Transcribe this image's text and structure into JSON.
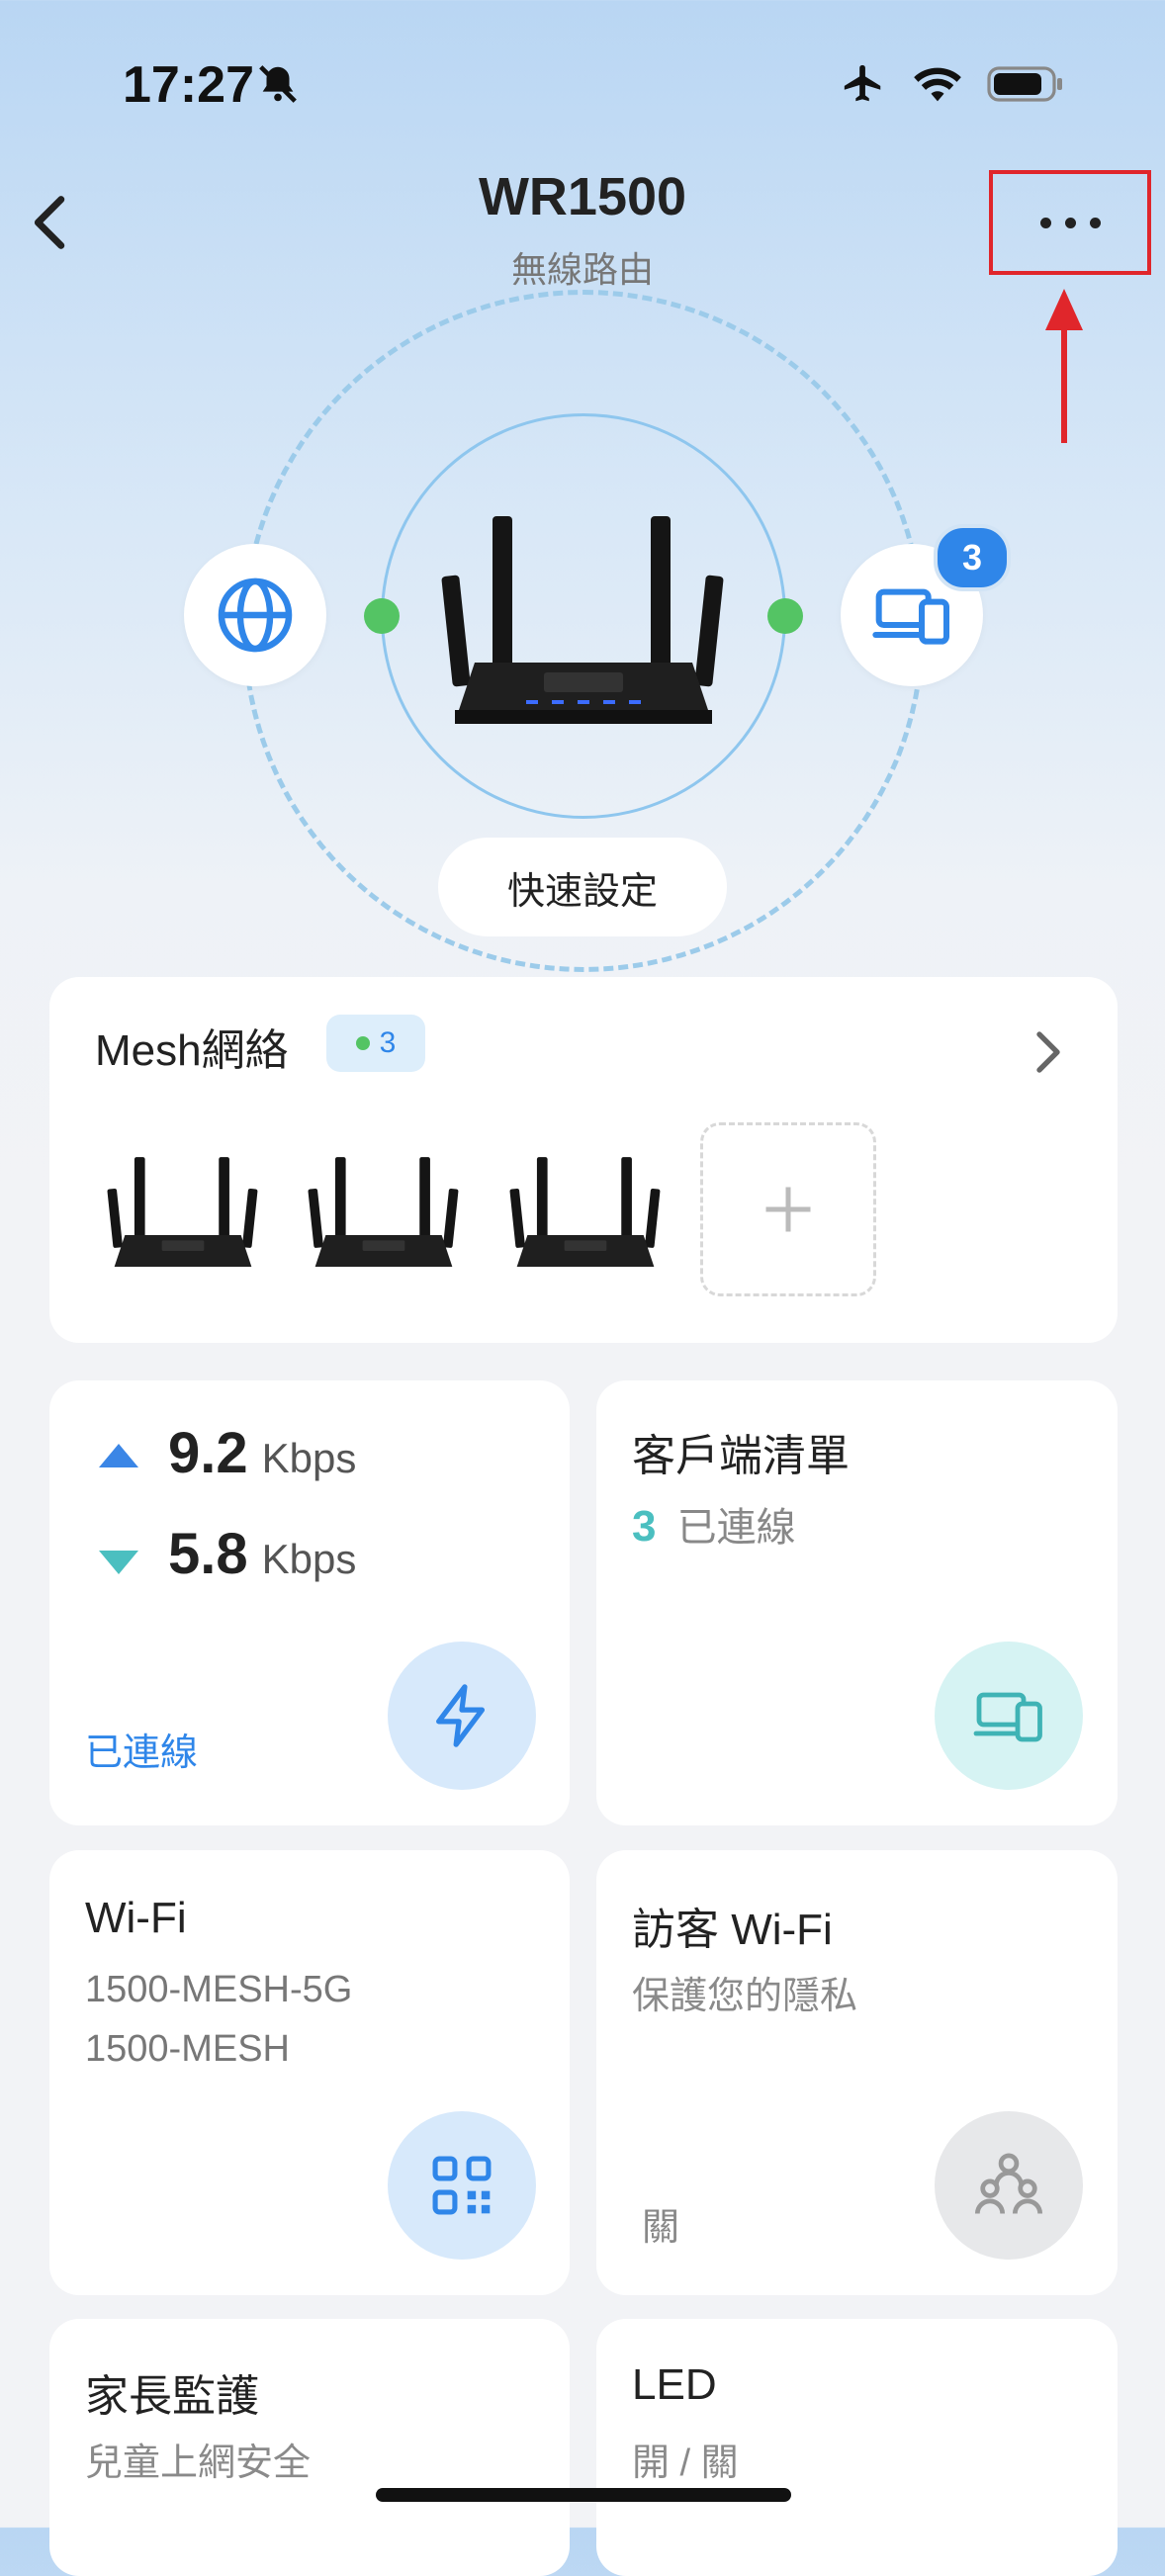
{
  "status_bar": {
    "time": "17:27"
  },
  "header": {
    "title": "WR1500",
    "subtitle": "無線路由"
  },
  "hero": {
    "devices_badge": "3",
    "quick_setup_label": "快速設定"
  },
  "mesh": {
    "title": "Mesh網絡",
    "count": "3"
  },
  "speed_card": {
    "upload_value": "9.2",
    "upload_unit": "Kbps",
    "download_value": "5.8",
    "download_unit": "Kbps",
    "status": "已連線"
  },
  "clients_card": {
    "title": "客戶端清單",
    "count": "3",
    "status": "已連線"
  },
  "wifi_card": {
    "title": "Wi-Fi",
    "ssid_5g": "1500-MESH-5G",
    "ssid_24g": "1500-MESH"
  },
  "guest_card": {
    "title": "訪客 Wi-Fi",
    "subtitle": "保護您的隱私",
    "state": "關"
  },
  "parental_card": {
    "title": "家長監護",
    "subtitle": "兒童上網安全"
  },
  "led_card": {
    "title": "LED",
    "subtitle": "開 / 關"
  },
  "colors": {
    "accent": "#2f86e9",
    "teal": "#4bbfc0",
    "annotation": "#e0262b",
    "online": "#54c464"
  }
}
